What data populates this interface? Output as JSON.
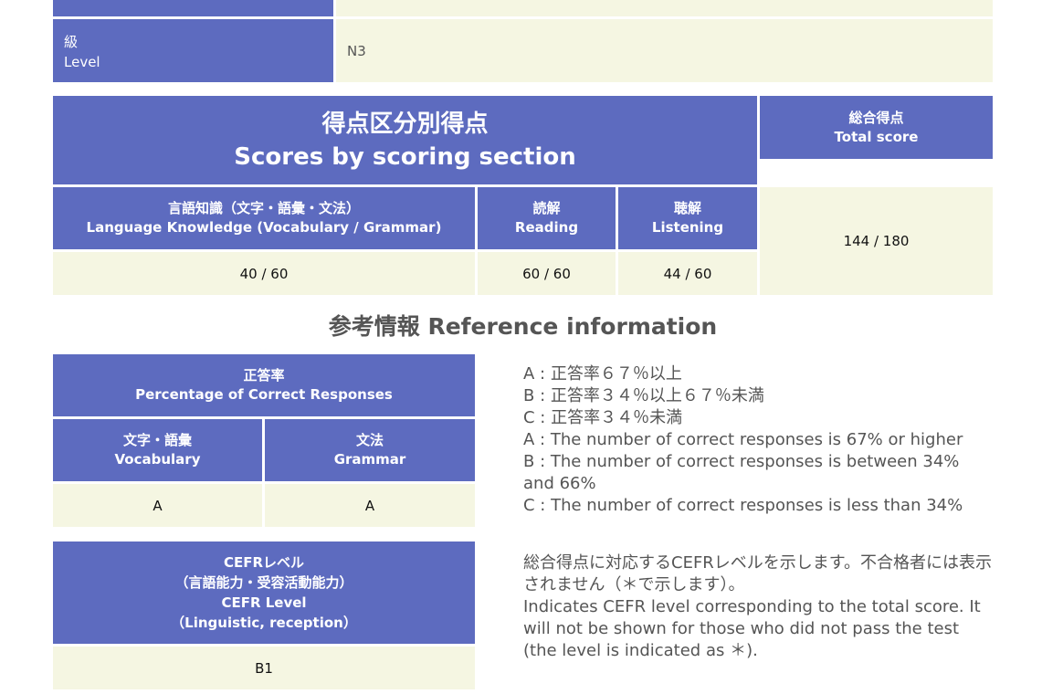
{
  "level_row": {
    "label_ja": "級",
    "label_en": "Level",
    "value": "N3"
  },
  "scores": {
    "section_title_ja": "得点区分別得点",
    "section_title_en": "Scores by scoring section",
    "total_title_ja": "総合得点",
    "total_title_en": "Total score",
    "total_value": "144 / 180",
    "sections": [
      {
        "label_ja": "言語知識（文字・語彙・文法）",
        "label_en": "Language Knowledge (Vocabulary / Grammar)",
        "value": "40 / 60"
      },
      {
        "label_ja": "読解",
        "label_en": "Reading",
        "value": "60 / 60"
      },
      {
        "label_ja": "聴解",
        "label_en": "Listening",
        "value": "44 / 60"
      }
    ]
  },
  "reference": {
    "title": "参考情報 Reference information",
    "correct": {
      "title_ja": "正答率",
      "title_en": "Percentage of Correct Responses",
      "columns": [
        {
          "label_ja": "文字・語彙",
          "label_en": "Vocabulary",
          "value": "A"
        },
        {
          "label_ja": "文法",
          "label_en": "Grammar",
          "value": "A"
        }
      ],
      "notes": [
        "A : 正答率６７％以上",
        "B : 正答率３４％以上６７％未満",
        "C : 正答率３４％未満",
        "A : The number of correct responses is 67% or higher",
        "B : The number of correct responses is between 34% and 66%",
        "C : The number of correct responses is less than 34%"
      ]
    },
    "cefr": {
      "title_line1": "CEFRレベル",
      "title_line2": "（言語能力・受容活動能力）",
      "title_line3": "CEFR Level",
      "title_line4": "（Linguistic, reception）",
      "value": "B1",
      "notes": [
        "総合得点に対応するCEFRレベルを示します。不合格者には表示されません（＊で示します）。",
        "Indicates CEFR level corresponding to the total score. It will not be shown for those who did not pass the test (the level is indicated as ＊)."
      ]
    }
  },
  "colors": {
    "header_bg": "#5d6bbf",
    "cell_bg": "#f5f6e2"
  }
}
